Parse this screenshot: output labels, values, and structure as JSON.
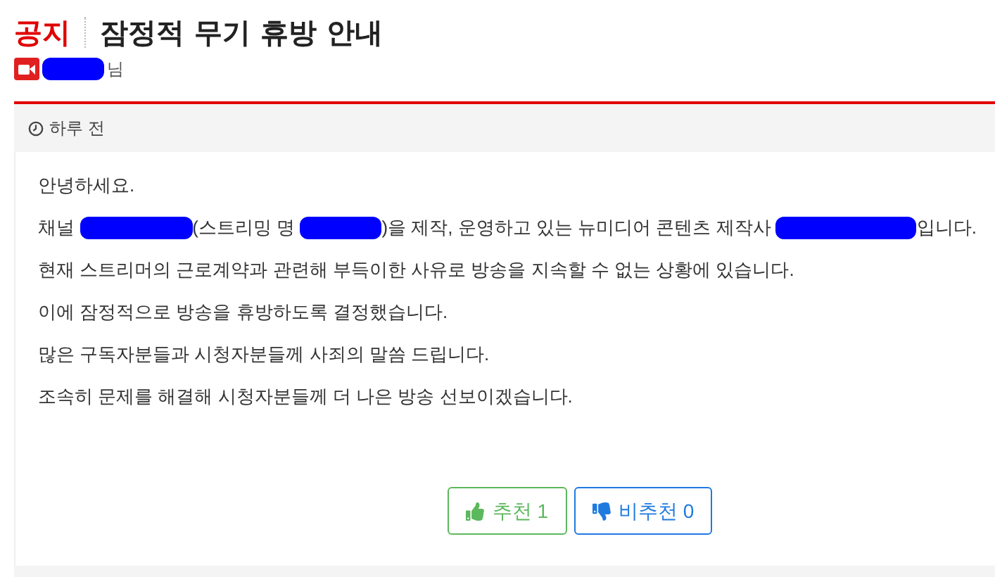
{
  "post": {
    "category": "공지",
    "title": "잠정적 무기 휴방 안내",
    "author_suffix": "님",
    "time": "하루 전"
  },
  "paragraphs": [
    {
      "parts": [
        {
          "kind": "text",
          "text": "안녕하세요."
        }
      ]
    },
    {
      "parts": [
        {
          "kind": "text",
          "text": "채널 "
        },
        {
          "kind": "redacted"
        },
        {
          "kind": "text",
          "text": "(스트리밍 명 "
        },
        {
          "kind": "redacted"
        },
        {
          "kind": "text",
          "text": ")을 제작, 운영하고 있는 뉴미디어 콘텐츠 제작사 "
        },
        {
          "kind": "redacted"
        },
        {
          "kind": "text",
          "text": "입니다."
        }
      ]
    },
    {
      "parts": [
        {
          "kind": "text",
          "text": "현재 스트리머의 근로계약과 관련해 부득이한 사유로 방송을 지속할 수 없는 상황에 있습니다."
        }
      ]
    },
    {
      "parts": [
        {
          "kind": "text",
          "text": "이에 잠정적으로 방송을 휴방하도록 결정했습니다."
        }
      ]
    },
    {
      "parts": [
        {
          "kind": "text",
          "text": "많은 구독자분들과 시청자분들께 사죄의 말씀 드립니다."
        }
      ]
    },
    {
      "parts": [
        {
          "kind": "text",
          "text": "조속히 문제를 해결해 시청자분들께 더 나은 방송 선보이겠습니다."
        }
      ]
    }
  ],
  "votes": [
    {
      "kind": "up",
      "label": "추천 1"
    },
    {
      "kind": "down",
      "label": "비추천 0"
    }
  ]
}
